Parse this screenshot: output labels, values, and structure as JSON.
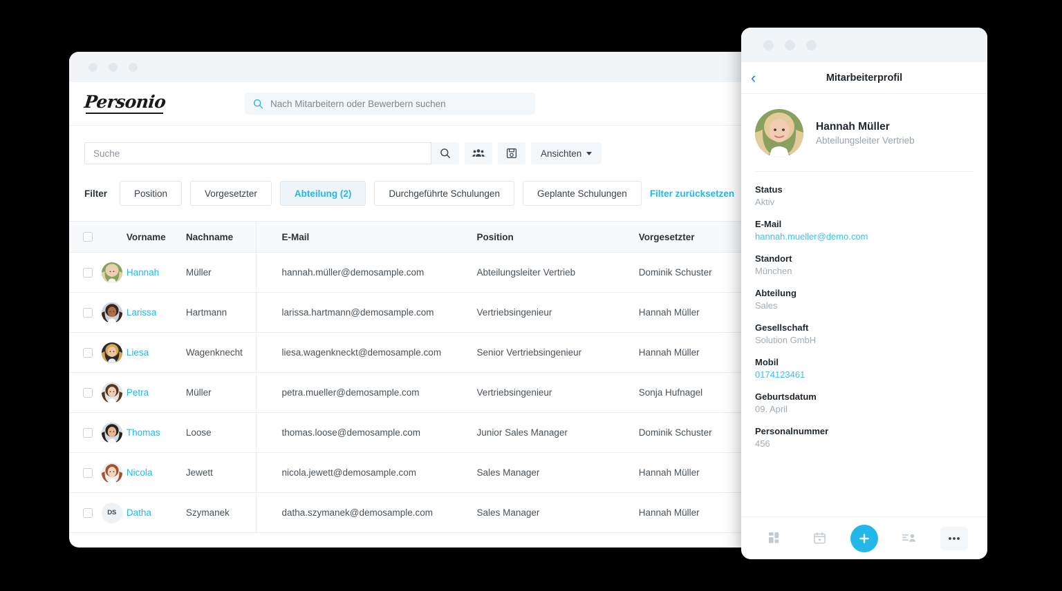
{
  "theme": {
    "background": "#000000",
    "accent": "#23b7ea",
    "link": "#23b7ea",
    "titlebar": "#f1f5f8",
    "panel_bg": "#ffffff",
    "header_row_bg": "#f7f9fb",
    "border": "#eaeef1"
  },
  "desktop": {
    "brand": {
      "name": "Personio"
    },
    "global_search": {
      "placeholder": "Nach Mitarbeitern oder Bewerbern suchen",
      "value": "",
      "icon": "search-icon"
    },
    "toolbar": {
      "search": {
        "placeholder": "Suche",
        "value": ""
      },
      "search_button_icon": "search-icon",
      "group_button_icon": "people-group-icon",
      "save_button_icon": "floppy-save-icon",
      "views_label": "Ansichten"
    },
    "filters": {
      "label": "Filter",
      "chips": [
        {
          "label": "Position",
          "active": false
        },
        {
          "label": "Vorgesetzter",
          "active": false
        },
        {
          "label": "Abteilung (2)",
          "active": true
        },
        {
          "label": "Durchgeführte Schulungen",
          "active": false
        },
        {
          "label": "Geplante Schulungen",
          "active": false
        }
      ],
      "reset_label": "Filter zurücksetzen"
    },
    "table": {
      "columns": [
        "Vorname",
        "Nachname",
        "E-Mail",
        "Position",
        "Vorgesetzter"
      ],
      "rows": [
        {
          "first_name": "Hannah",
          "last_name": "Müller",
          "email": "hannah.müller@demosample.com",
          "position": "Abteilungsleiter Vertrieb",
          "supervisor": "Dominik Schuster",
          "avatar": {
            "type": "photo",
            "hair": "#e6d2a8",
            "skin": "#f2cdb4",
            "bg": "#87a05e"
          }
        },
        {
          "first_name": "Larissa",
          "last_name": "Hartmann",
          "email": "larissa.hartmann@demosample.com",
          "position": "Vertriebsingenieur",
          "supervisor": "Hannah Müller",
          "avatar": {
            "type": "photo",
            "hair": "#3a2418",
            "skin": "#a9714a",
            "bg": "#c9d3da"
          }
        },
        {
          "first_name": "Liesa",
          "last_name": "Wagenknecht",
          "email": "liesa.wagenkneckt@demosample.com",
          "position": "Senior Vertriebsingenieur",
          "supervisor": "Hannah Müller",
          "avatar": {
            "type": "photo",
            "hair": "#d8a64e",
            "skin": "#eec6a6",
            "bg": "#2a2a30"
          }
        },
        {
          "first_name": "Petra",
          "last_name": "Müller",
          "email": "petra.mueller@demosample.com",
          "position": "Vertriebsingenieur",
          "supervisor": "Sonja Hufnagel",
          "avatar": {
            "type": "photo",
            "hair": "#5b3420",
            "skin": "#f0cdb2",
            "bg": "#dfe6ea"
          }
        },
        {
          "first_name": "Thomas",
          "last_name": "Loose",
          "email": "thomas.loose@demosample.com",
          "position": "Junior Sales Manager",
          "supervisor": "Dominik Schuster",
          "avatar": {
            "type": "photo",
            "hair": "#2b2018",
            "skin": "#e4b694",
            "bg": "#cfdde2"
          }
        },
        {
          "first_name": "Nicola",
          "last_name": "Jewett",
          "email": "nicola.jewett@demosample.com",
          "position": "Sales Manager",
          "supervisor": "Hannah Müller",
          "avatar": {
            "type": "photo",
            "hair": "#a5522a",
            "skin": "#f3d6c0",
            "bg": "#eceff1"
          }
        },
        {
          "first_name": "Datha",
          "last_name": "Szymanek",
          "email": "datha.szymanek@demosample.com",
          "position": "Sales Manager",
          "supervisor": "Hannah Müller",
          "avatar": {
            "type": "initials",
            "initials": "DS"
          }
        }
      ]
    }
  },
  "mobile": {
    "back_icon": "chevron-left-icon",
    "title": "Mitarbeiterprofil",
    "profile": {
      "name": "Hannah Müller",
      "role": "Abteilungsleiter Vertrieb",
      "avatar": {
        "hair": "#e3cb9c",
        "skin": "#f2cdb4",
        "bg": "#8aa05f"
      }
    },
    "fields": [
      {
        "label": "Status",
        "value": "Aktiv",
        "link": false
      },
      {
        "label": "E-Mail",
        "value": "hannah.mueller@demo.com",
        "link": true
      },
      {
        "label": "Standort",
        "value": "München",
        "link": false
      },
      {
        "label": "Abteilung",
        "value": "Sales",
        "link": false
      },
      {
        "label": "Gesellschaft",
        "value": "Solution GmbH",
        "link": false
      },
      {
        "label": "Mobil",
        "value": "0174123461",
        "link": true
      },
      {
        "label": "Geburtsdatum",
        "value": "09. April",
        "link": false
      },
      {
        "label": "Personalnummer",
        "value": "456",
        "link": false
      }
    ],
    "tabbar": [
      {
        "icon": "dashboard-grid-icon",
        "boxed": false
      },
      {
        "icon": "calendar-icon",
        "boxed": false
      },
      {
        "icon": "plus-icon",
        "fab": true
      },
      {
        "icon": "person-list-icon",
        "boxed": false
      },
      {
        "icon": "more-ellipsis-icon",
        "boxed": true
      }
    ]
  }
}
